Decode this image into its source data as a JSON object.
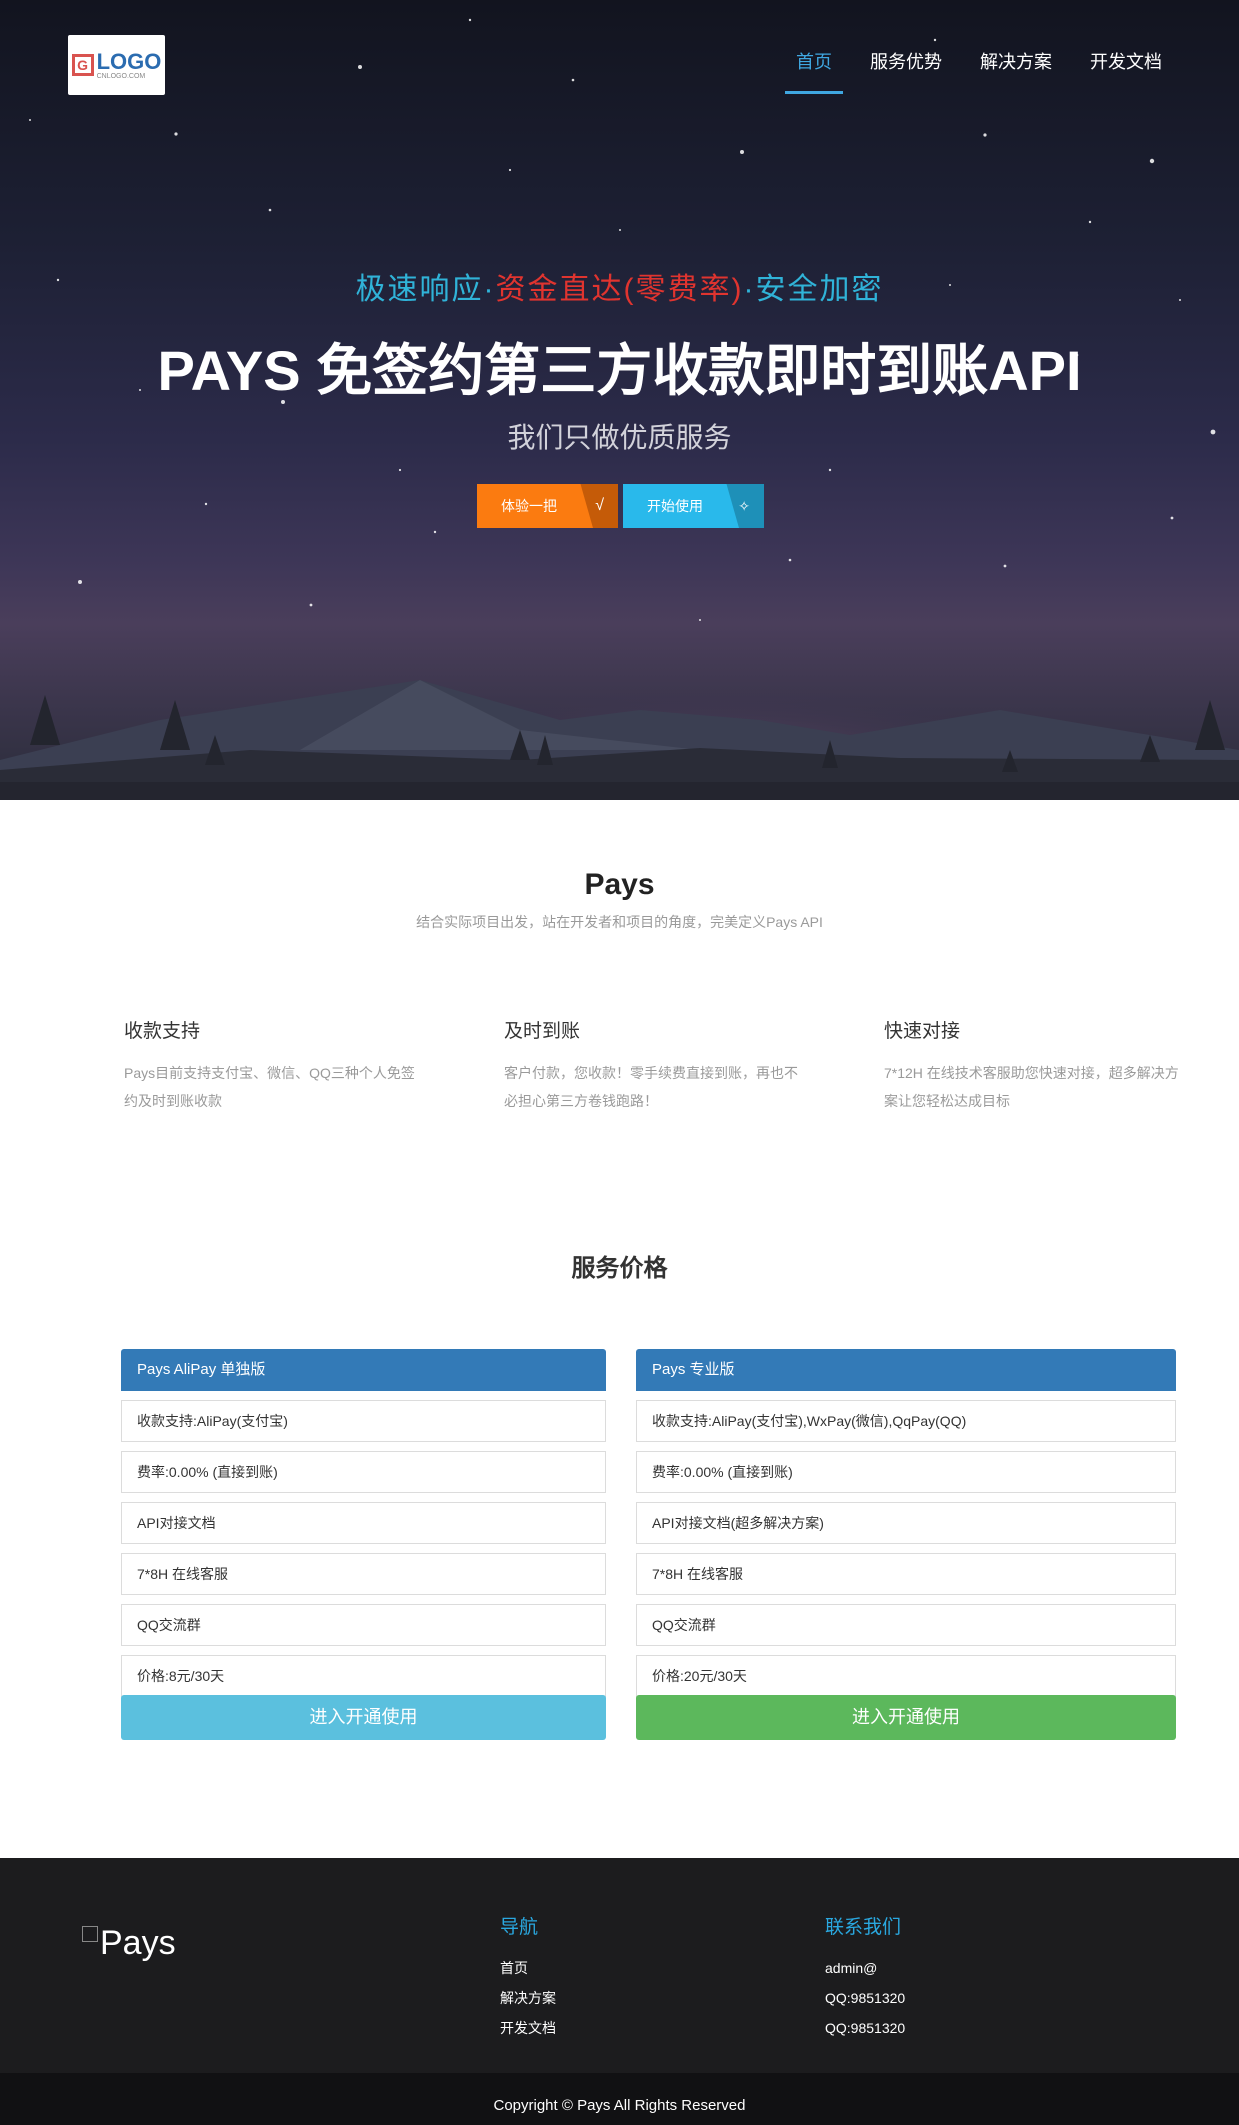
{
  "header": {
    "logo": {
      "mark": "G",
      "word": "LOGO",
      "sub": "CNLOGO.COM"
    },
    "nav": [
      {
        "label": "首页",
        "active": true
      },
      {
        "label": "服务优势",
        "active": false
      },
      {
        "label": "解决方案",
        "active": false
      },
      {
        "label": "开发文档",
        "active": false
      }
    ]
  },
  "hero": {
    "tagline_part1": "极速响应·",
    "tagline_part2": "资金直达(零费率)",
    "tagline_part3": "·安全加密",
    "title": "PAYS 免签约第三方收款即时到账API",
    "subtitle": "我们只做优质服务",
    "buttons": [
      {
        "label": "体验一把",
        "icon": "√",
        "icon_name": "check-icon"
      },
      {
        "label": "开始使用",
        "icon": "✧",
        "icon_name": "sparkle-icon"
      }
    ]
  },
  "features_section": {
    "title": "Pays",
    "subtitle": "结合实际项目出发，站在开发者和项目的角度，完美定义Pays API",
    "items": [
      {
        "title": "收款支持",
        "desc": "Pays目前支持支付宝、微信、QQ三种个人免签约及时到账收款"
      },
      {
        "title": "及时到账",
        "desc": "客户付款，您收款！零手续费直接到账，再也不必担心第三方卷钱跑路！"
      },
      {
        "title": "快速对接",
        "desc": "7*12H 在线技术客服助您快速对接，超多解决方案让您轻松达成目标"
      }
    ]
  },
  "pricing": {
    "title": "服务价格",
    "plans": [
      {
        "name": "Pays AliPay 单独版",
        "rows": [
          "收款支持:AliPay(支付宝)",
          "费率:0.00% (直接到账)",
          "API对接文档",
          "7*8H 在线客服",
          "QQ交流群",
          "价格:8元/30天"
        ],
        "button": "进入开通使用"
      },
      {
        "name": "Pays 专业版",
        "rows": [
          "收款支持:AliPay(支付宝),WxPay(微信),QqPay(QQ)",
          "费率:0.00% (直接到账)",
          "API对接文档(超多解决方案)",
          "7*8H 在线客服",
          "QQ交流群",
          "价格:20元/30天"
        ],
        "button": "进入开通使用"
      }
    ]
  },
  "footer": {
    "logo_alt": "Pays",
    "nav_title": "导航",
    "nav_links": [
      "首页",
      "解决方案",
      "开发文档"
    ],
    "contact_title": "联系我们",
    "contact_lines": [
      "admin@",
      "QQ:9851320",
      "QQ:9851320"
    ],
    "copyright": "Copyright © Pays All Rights Reserved"
  },
  "colors": {
    "accent_blue": "#3fa7e1",
    "tagline_red": "#e0342f",
    "btn_orange": "#fb7b10",
    "btn_cyan": "#29b9eb",
    "plan_header": "#337ab7",
    "btn_info": "#5bc0de",
    "btn_success": "#5cb85c"
  }
}
